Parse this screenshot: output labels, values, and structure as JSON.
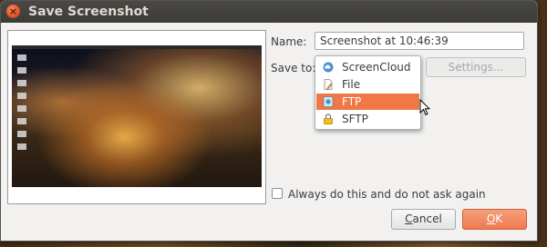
{
  "window": {
    "title": "Save Screenshot"
  },
  "form": {
    "name_label": "Name:",
    "name_value": "Screenshot at 10:46:39",
    "saveto_label": "Save to:",
    "settings_label": "Settings..."
  },
  "dropdown": {
    "items": [
      {
        "label": "ScreenCloud",
        "icon": "cloud-icon",
        "selected": false
      },
      {
        "label": "File",
        "icon": "file-icon",
        "selected": false
      },
      {
        "label": "FTP",
        "icon": "ftp-icon",
        "selected": true
      },
      {
        "label": "SFTP",
        "icon": "sftp-lock-icon",
        "selected": false
      }
    ]
  },
  "options": {
    "always_label": "Always do this and do not ask again",
    "always_checked": false
  },
  "buttons": {
    "cancel_label": "Cancel",
    "ok_label": "OK"
  },
  "colors": {
    "accent": "#f07746",
    "titlebar": "#3c3b37",
    "close": "#e25322"
  }
}
